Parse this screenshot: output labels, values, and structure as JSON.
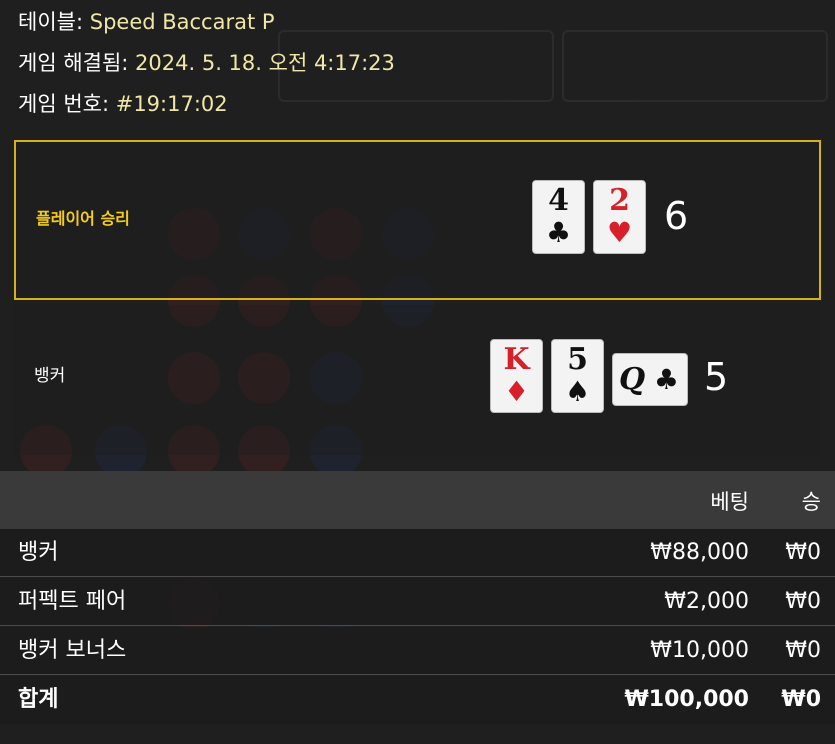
{
  "header": {
    "table_label": "테이블:",
    "table_value": "Speed Baccarat P",
    "resolved_label": "게임 해결됨:",
    "resolved_value": "2024. 5. 18. 오전 4:17:23",
    "game_no_label": "게임 번호:",
    "game_no_value": "#19:17:02"
  },
  "player": {
    "label": "플레이어 승리",
    "cards": [
      {
        "rank": "4",
        "suit": "♣",
        "color": "#111111"
      },
      {
        "rank": "2",
        "suit": "♥",
        "color": "#d8202a"
      }
    ],
    "score": "6",
    "highlight_color": "#d8b318"
  },
  "banker": {
    "label": "뱅커",
    "cards": [
      {
        "rank": "K",
        "suit": "♦",
        "color": "#d8202a"
      },
      {
        "rank": "5",
        "suit": "♠",
        "color": "#111111"
      },
      {
        "rank": "Q",
        "suit": "♣",
        "color": "#111111",
        "sideways": true
      }
    ],
    "score": "5"
  },
  "bets_table": {
    "headers": {
      "bet": "베팅",
      "win": "승"
    },
    "rows": [
      {
        "name": "뱅커",
        "bet": "₩88,000",
        "win": "₩0"
      },
      {
        "name": "퍼펙트 페어",
        "bet": "₩2,000",
        "win": "₩0"
      },
      {
        "name": "뱅커 보너스",
        "bet": "₩10,000",
        "win": "₩0"
      }
    ],
    "total": {
      "name": "합계",
      "bet": "₩100,000",
      "win": "₩0"
    }
  }
}
